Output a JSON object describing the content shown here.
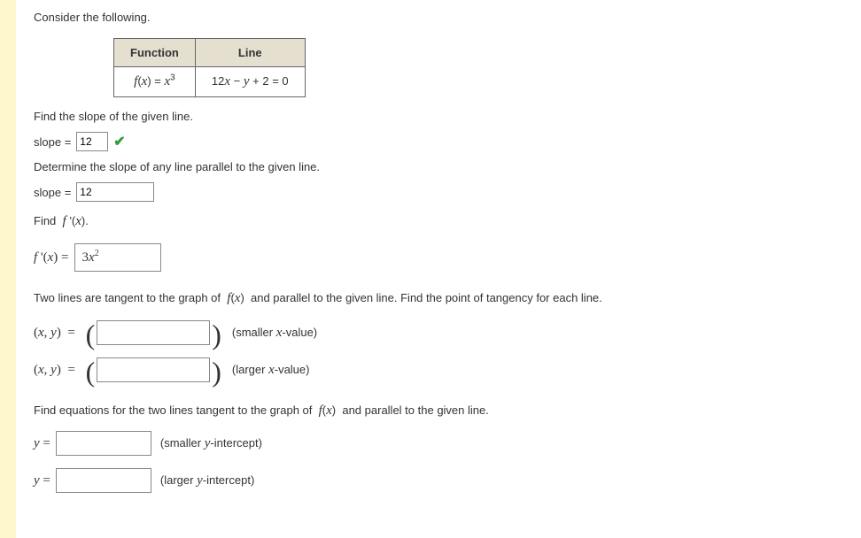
{
  "intro": "Consider the following.",
  "table": {
    "h1": "Function",
    "h2": "Line",
    "c1_html": "<span class='math-i'>f</span>(<span class='math-i'>x</span>) = <span class='math-i'>x</span><sup>3</sup>",
    "c2_html": "12<span class='math-i'>x</span> − <span class='math-i'>y</span> + 2 = 0"
  },
  "q1": {
    "prompt": "Find the slope of the given line.",
    "label": "slope = ",
    "value": "12"
  },
  "q2": {
    "prompt": "Determine the slope of any line parallel to the given line.",
    "label": "slope = ",
    "value": "12"
  },
  "q3": {
    "prompt_html": "Find&nbsp; <span class='math-i'>f </span>'(<span class='math-i'>x</span>).",
    "label_html": "<span class='math-i'>f </span>'(<span class='math-i'>x</span>) = ",
    "value_html": "3<span class='math-i'>x</span><sup>2</sup>"
  },
  "q4": {
    "prompt_html": "Two lines are tangent to the graph of&nbsp; <span class='math-i'>f</span>(<span class='math-i'>x</span>)&nbsp; and parallel to the given line. Find the point of tangency for each line.",
    "xy_label_html": "(<span class='math-i'>x</span>, <span class='math-i'>y</span>) &nbsp;=&nbsp;",
    "hint1": "(smaller x-value)",
    "hint2": "(larger x-value)",
    "hint1_html": "(smaller <span class='math-i'>x</span>-value)",
    "hint2_html": "(larger <span class='math-i'>x</span>-value)"
  },
  "q5": {
    "prompt_html": "Find equations for the two lines tangent to the graph of&nbsp; <span class='math-i'>f</span>(<span class='math-i'>x</span>)&nbsp; and parallel to the given line.",
    "y_label_html": "<span class='math-i'>y</span> = ",
    "hint1_html": "(smaller <span class='math-i'>y</span>-intercept)",
    "hint2_html": "(larger <span class='math-i'>y</span>-intercept)"
  }
}
